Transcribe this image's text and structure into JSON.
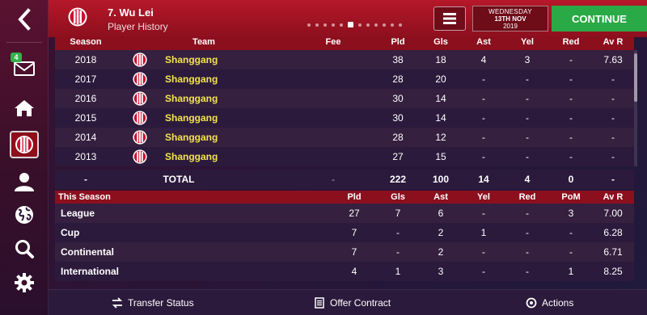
{
  "header": {
    "player_name": "7. Wu Lei",
    "subtitle": "Player History",
    "pages_count": 12,
    "active_page": 5,
    "date": {
      "weekday": "WEDNESDAY",
      "day_month": "13TH NOV",
      "year": "2019"
    },
    "continue_label": "CONTINUE"
  },
  "sidebar": {
    "inbox_badge": "4",
    "items": [
      "back-icon",
      "inbox-icon",
      "home-icon",
      "club-icon",
      "people-icon",
      "globe-icon",
      "search-icon",
      "settings-icon"
    ]
  },
  "history": {
    "columns": {
      "season": "Season",
      "team": "Team",
      "fee": "Fee",
      "pld": "Pld",
      "gls": "Gls",
      "ast": "Ast",
      "yel": "Yel",
      "red": "Red",
      "avr": "Av R"
    },
    "rows": [
      {
        "season": "2018",
        "team": "Shanggang",
        "fee": "",
        "pld": "38",
        "gls": "18",
        "ast": "4",
        "yel": "3",
        "red": "-",
        "avr": "7.63"
      },
      {
        "season": "2017",
        "team": "Shanggang",
        "fee": "",
        "pld": "28",
        "gls": "20",
        "ast": "-",
        "yel": "-",
        "red": "-",
        "avr": "-"
      },
      {
        "season": "2016",
        "team": "Shanggang",
        "fee": "",
        "pld": "30",
        "gls": "14",
        "ast": "-",
        "yel": "-",
        "red": "-",
        "avr": "-"
      },
      {
        "season": "2015",
        "team": "Shanggang",
        "fee": "",
        "pld": "30",
        "gls": "14",
        "ast": "-",
        "yel": "-",
        "red": "-",
        "avr": "-"
      },
      {
        "season": "2014",
        "team": "Shanggang",
        "fee": "",
        "pld": "28",
        "gls": "12",
        "ast": "-",
        "yel": "-",
        "red": "-",
        "avr": "-"
      },
      {
        "season": "2013",
        "team": "Shanggang",
        "fee": "",
        "pld": "27",
        "gls": "15",
        "ast": "-",
        "yel": "-",
        "red": "-",
        "avr": "-"
      }
    ],
    "total": {
      "season": "-",
      "label": "TOTAL",
      "fee": "-",
      "pld": "222",
      "gls": "100",
      "ast": "14",
      "yel": "4",
      "red": "0",
      "avr": "-"
    }
  },
  "this_season": {
    "columns": {
      "title": "This Season",
      "pld": "Pld",
      "gls": "Gls",
      "ast": "Ast",
      "yel": "Yel",
      "red": "Red",
      "pom": "PoM",
      "avr": "Av R"
    },
    "rows": [
      {
        "comp": "League",
        "pld": "27",
        "gls": "7",
        "ast": "6",
        "yel": "-",
        "red": "-",
        "pom": "3",
        "avr": "7.00"
      },
      {
        "comp": "Cup",
        "pld": "7",
        "gls": "-",
        "ast": "2",
        "yel": "1",
        "red": "-",
        "pom": "-",
        "avr": "6.28"
      },
      {
        "comp": "Continental",
        "pld": "7",
        "gls": "-",
        "ast": "2",
        "yel": "-",
        "red": "-",
        "pom": "-",
        "avr": "6.71"
      },
      {
        "comp": "International",
        "pld": "4",
        "gls": "1",
        "ast": "3",
        "yel": "-",
        "red": "-",
        "pom": "1",
        "avr": "8.25"
      }
    ]
  },
  "bottom_bar": {
    "transfer_status": "Transfer Status",
    "offer_contract": "Offer Contract",
    "actions": "Actions"
  },
  "colors": {
    "header_red": "#b5182a",
    "continue_green": "#2aa947",
    "team_yellow": "#f4e44a",
    "badge_green": "#34b24a"
  }
}
